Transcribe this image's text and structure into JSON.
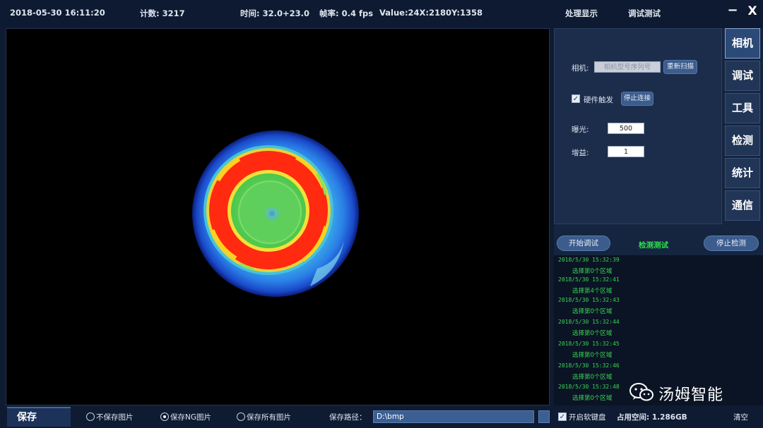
{
  "topbar": {
    "datetime": "2018-05-30 16:11:20",
    "count": "计数: 3217",
    "time": "时间: 32.0+23.0",
    "framerate": "帧率: 0.4 fps",
    "value": "Value:24X:2180Y:1358",
    "menu_process": "处理显示",
    "menu_debug": "调试测试",
    "minimize": "−",
    "close": "X"
  },
  "settings": {
    "camera_label": "相机:",
    "camera_value": "相机型号序列号",
    "camera_button": "重新扫描",
    "hw_trigger_label": "硬件触发",
    "hw_trigger_checked": true,
    "stop_capture_button": "停止连接",
    "exposure_label": "曝光:",
    "exposure_value": "500",
    "gain_label": "增益:",
    "gain_value": "1"
  },
  "tabs": [
    "相机",
    "调试",
    "工具",
    "检测",
    "统计",
    "通信"
  ],
  "active_tab": 0,
  "detect": {
    "start_debug": "开始调试",
    "status": "检测测试",
    "stop_detect": "停止检测"
  },
  "log": [
    "2018/5/30 15:32:39",
    "选择第0个区域",
    "2018/5/30 15:32:41",
    "选择第4个区域",
    "2018/5/30 15:32:43",
    "选择第0个区域",
    "2018/5/30 15:32:44",
    "选择第0个区域",
    "2018/5/30 15:32:45",
    "选择第0个区域",
    "2018/5/30 15:32:46",
    "选择第0个区域",
    "2018/5/30 15:32:48",
    "选择第0个区域"
  ],
  "watermark": "汤姆智能",
  "bottom": {
    "title": "保存",
    "opt_none": "不保存图片",
    "opt_ng": "保存NG图片",
    "opt_all": "保存所有图片",
    "selected_option": "opt_ng",
    "path_label": "保存路径：",
    "path_value": "D:\\bmp",
    "soft_keyboard": "开启软键盘",
    "soft_keyboard_checked": true,
    "disk_usage": "占用空间: 1.286GB",
    "clear": "清空"
  },
  "colors": {
    "background": "#0f1b30",
    "accent_button": "#3b5c8c",
    "log_text": "#39d455",
    "thermal_blue": "#1e5de0",
    "thermal_cyan": "#45c8e8",
    "thermal_green": "#5fd35a",
    "thermal_red": "#ff2a10"
  }
}
